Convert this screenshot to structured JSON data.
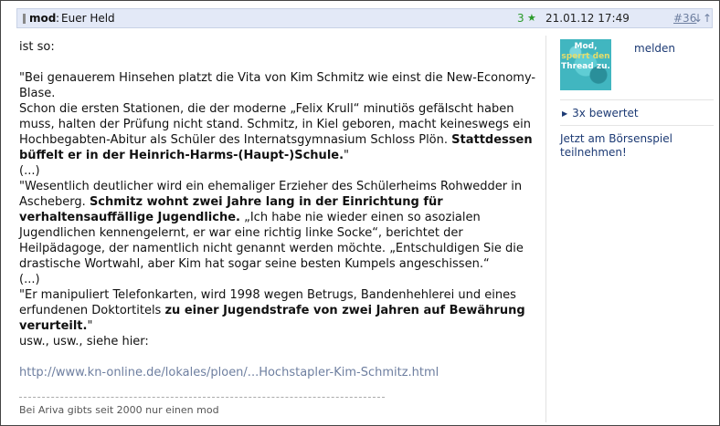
{
  "header": {
    "user": "mod",
    "separator": ":",
    "title": "Euer Held",
    "rating_count": "3",
    "rating_icon": "star-icon",
    "datetime": "21.01.12 17:49",
    "post_number": "#36",
    "nav_arrows": "↓↑"
  },
  "post": {
    "line1": "ist so:",
    "p1a": "\"Bei genauerem Hinsehen platzt die Vita von Kim Schmitz wie einst die New-Economy-Blase.",
    "p1b": "Schon die ersten Stationen, die der moderne „Felix Krull“ minutiös gefälscht haben muss, halten der Prüfung nicht stand. Schmitz, in Kiel geboren, macht keineswegs ein Hochbegabten-Abitur als Schüler des Internatsgymnasium Schloss Plön. ",
    "p1b_bold": "Stattdessen büffelt er in der Heinrich-Harms-(Haupt-)Schule.",
    "p1b_end": "\"",
    "ellipsis1": "(...)",
    "p2a": "\"Wesentlich deutlicher wird ein ehemaliger Erzieher des Schülerheims Rohwedder in Ascheberg. ",
    "p2_bold": "Schmitz wohnt zwei Jahre lang in der Einrichtung für verhaltensauffällige Jugendliche.",
    "p2b": " „Ich habe nie wieder einen so asozialen Jugendlichen kennengelernt, er war eine richtig linke Socke“, berichtet der Heilpädagoge, der namentlich nicht genannt werden möchte. „Entschuldigen Sie die drastische Wortwahl, aber Kim hat sogar seine besten Kumpels angeschissen.“",
    "ellipsis2": "(...)",
    "p3a": "\"Er manipuliert Telefonkarten, wird 1998 wegen Betrugs, Bandenhehlerei und eines erfundenen Doktortitels ",
    "p3_bold": "zu einer Jugendstrafe von zwei Jahren auf Bewährung verurteilt.",
    "p3_end": "\"",
    "usw": "usw., usw., siehe hier:",
    "link": "http://www.kn-online.de/lokales/ploen/...Hochstapler-Kim-Schmitz.html",
    "signature": "Bei Ariva gibts seit 2000 nur einen mod"
  },
  "sidebar": {
    "avatar_lines": [
      "Mod,",
      "sperrt den",
      "Thread zu."
    ],
    "report": "melden",
    "rated": "3x bewertet",
    "boersenspiel": "Jetzt am Börsenspiel teilnehmen!"
  },
  "colors": {
    "header_bg": "#e3e9f7",
    "link": "#6e7fa0",
    "sidebar_link": "#1c3a74",
    "rating_green": "#2a9a2a"
  }
}
